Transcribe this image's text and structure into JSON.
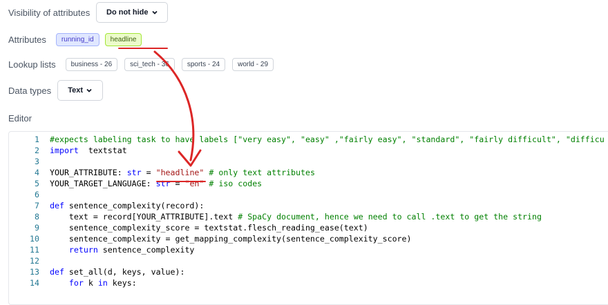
{
  "visibility": {
    "label": "Visibility of attributes",
    "value": "Do not hide"
  },
  "attributes": {
    "label": "Attributes",
    "items": [
      "running_id",
      "headline"
    ]
  },
  "lookup": {
    "label": "Lookup lists",
    "items": [
      "business - 26",
      "sci_tech - 36",
      "sports - 24",
      "world - 29"
    ]
  },
  "datatypes": {
    "label": "Data types",
    "value": "Text"
  },
  "editor": {
    "label": "Editor",
    "lines": [
      {
        "n": "1",
        "parts": [
          [
            "cm",
            "#expects labeling task to have labels [\"very easy\", \"easy\" ,\"fairly easy\", \"standard\", \"fairly difficult\", \"difficu"
          ]
        ]
      },
      {
        "n": "2",
        "parts": [
          [
            "kw",
            "import"
          ],
          [
            "",
            "  textstat"
          ]
        ]
      },
      {
        "n": "3",
        "parts": []
      },
      {
        "n": "4",
        "parts": [
          [
            "",
            "YOUR_ATTRIBUTE: "
          ],
          [
            "kw",
            "str"
          ],
          [
            "",
            " = "
          ],
          [
            "st",
            "\"headline\""
          ],
          [
            "",
            " "
          ],
          [
            "cm",
            "# only text attributes"
          ]
        ]
      },
      {
        "n": "5",
        "parts": [
          [
            "",
            "YOUR_TARGET_LANGUAGE: "
          ],
          [
            "kw",
            "str"
          ],
          [
            "",
            " = "
          ],
          [
            "st",
            "\"en\""
          ],
          [
            "",
            " "
          ],
          [
            "cm",
            "# iso codes"
          ]
        ]
      },
      {
        "n": "6",
        "parts": []
      },
      {
        "n": "7",
        "parts": [
          [
            "kw",
            "def"
          ],
          [
            "",
            " sentence_complexity(record):"
          ]
        ]
      },
      {
        "n": "8",
        "parts": [
          [
            "",
            "    text = record[YOUR_ATTRIBUTE].text "
          ],
          [
            "cm",
            "# SpaCy document, hence we need to call .text to get the string"
          ]
        ]
      },
      {
        "n": "9",
        "parts": [
          [
            "",
            "    sentence_complexity_score = textstat.flesch_reading_ease(text)"
          ]
        ]
      },
      {
        "n": "10",
        "parts": [
          [
            "",
            "    sentence_complexity = get_mapping_complexity(sentence_complexity_score)"
          ]
        ]
      },
      {
        "n": "11",
        "parts": [
          [
            "",
            "    "
          ],
          [
            "kw",
            "return"
          ],
          [
            "",
            " sentence_complexity"
          ]
        ]
      },
      {
        "n": "12",
        "parts": []
      },
      {
        "n": "13",
        "parts": [
          [
            "kw",
            "def"
          ],
          [
            "",
            " set_all(d, keys, value):"
          ]
        ]
      },
      {
        "n": "14",
        "parts": [
          [
            "",
            "    "
          ],
          [
            "kw",
            "for"
          ],
          [
            "",
            " k "
          ],
          [
            "kw",
            "in"
          ],
          [
            "",
            " keys:"
          ]
        ]
      }
    ]
  },
  "colors": {
    "annotation": "#dc2626",
    "accent_blue": "#4338ca",
    "accent_green": "#3f6212"
  }
}
